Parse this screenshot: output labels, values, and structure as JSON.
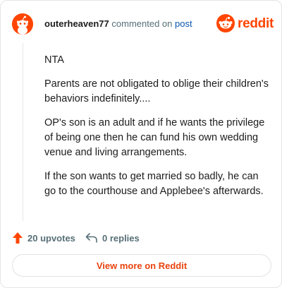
{
  "comment": {
    "username": "outerheaven77",
    "action_text": "commented on",
    "post_link_text": "post",
    "paragraphs": [
      "NTA",
      "Parents are not obligated to oblige their children's behaviors indefinitely....",
      "OP's son is an adult and if he wants the privilege of being one then he can fund his own wedding venue and living arrangements.",
      "If the son wants to get married so badly, he can go to the courthouse and Applebee's afterwards."
    ]
  },
  "brand": {
    "wordmark": "reddit",
    "icon": "reddit-logo-icon"
  },
  "footer": {
    "upvotes_label": "20 upvotes",
    "replies_label": "0 replies",
    "view_more_label": "View more on Reddit"
  },
  "colors": {
    "accent": "#ff4500",
    "link": "#0a58b0",
    "muted": "#576f76",
    "button_text": "#e8430f"
  }
}
